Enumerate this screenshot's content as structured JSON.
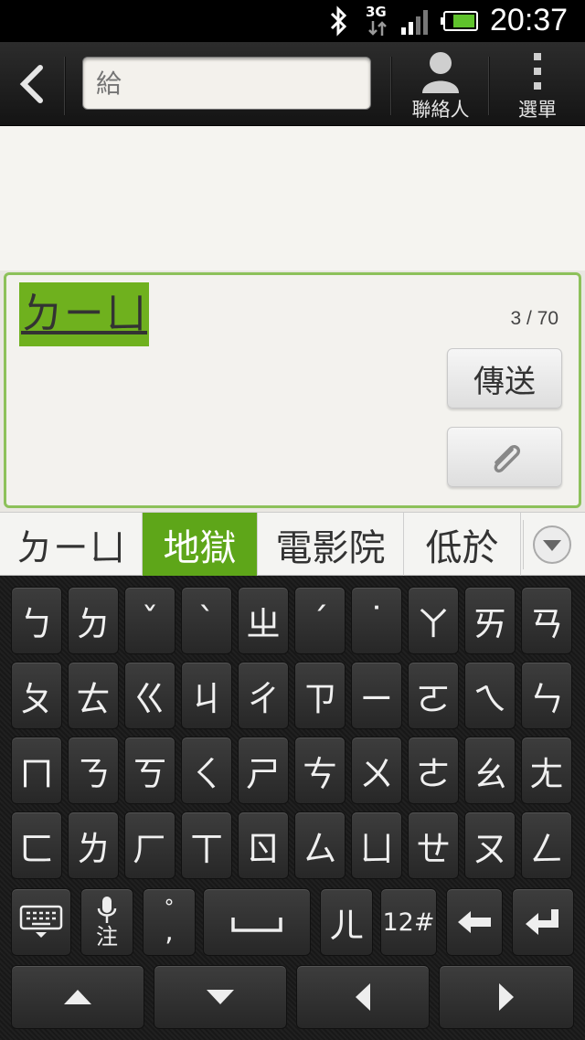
{
  "status_bar": {
    "network": "3G",
    "time": "20:37"
  },
  "action_bar": {
    "to_placeholder": "給",
    "contacts_label": "聯絡人",
    "menu_label": "選單"
  },
  "composer": {
    "composing_text": "ㄉㄧㄩ",
    "char_count": "3 / 70",
    "send_label": "傳送"
  },
  "candidates": [
    {
      "text": "ㄉㄧㄩ",
      "selected": false
    },
    {
      "text": "地獄",
      "selected": true
    },
    {
      "text": "電影院",
      "selected": false
    },
    {
      "text": "低於",
      "selected": false
    }
  ],
  "keyboard": {
    "rows": [
      [
        "ㄅ",
        "ㄉ",
        "ˇ",
        "ˋ",
        "ㄓ",
        "ˊ",
        "˙",
        "ㄚ",
        "ㄞ",
        "ㄢ"
      ],
      [
        "ㄆ",
        "ㄊ",
        "ㄍ",
        "ㄐ",
        "ㄔ",
        "ㄗ",
        "ㄧ",
        "ㄛ",
        "ㄟ",
        "ㄣ"
      ],
      [
        "ㄇ",
        "ㄋ",
        "ㄎ",
        "ㄑ",
        "ㄕ",
        "ㄘ",
        "ㄨ",
        "ㄜ",
        "ㄠ",
        "ㄤ"
      ],
      [
        "ㄈ",
        "ㄌ",
        "ㄏ",
        "ㄒ",
        "ㄖ",
        "ㄙ",
        "ㄩ",
        "ㄝ",
        "ㄡ",
        "ㄥ"
      ]
    ],
    "mic_label": "注",
    "punct_top": "°",
    "punct_bottom": ",",
    "er_key": "ㄦ",
    "num_key": "12#",
    "accent_color": "#5ea619"
  }
}
